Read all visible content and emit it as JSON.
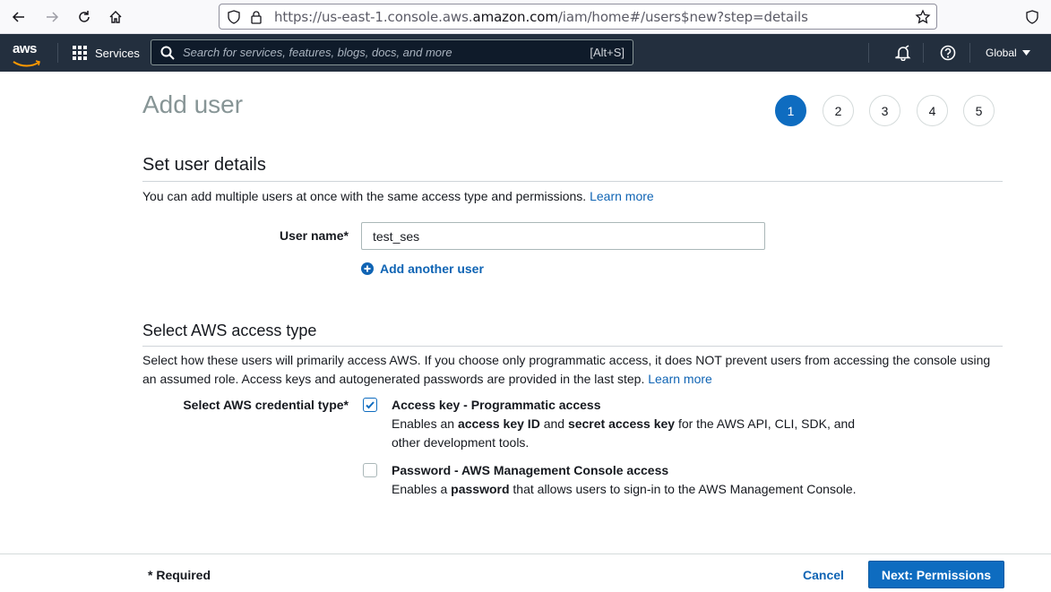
{
  "browser": {
    "url_prefix": "https://us-east-1.console.aws.",
    "url_host": "amazon.com",
    "url_path": "/iam/home#/users$new?step=details"
  },
  "aws_nav": {
    "logo": "aws",
    "services_label": "Services",
    "search_placeholder": "Search for services, features, blogs, docs, and more",
    "search_shortcut": "[Alt+S]",
    "region_label": "Global"
  },
  "page": {
    "title": "Add user",
    "steps": [
      "1",
      "2",
      "3",
      "4",
      "5"
    ],
    "active_step": 1
  },
  "user_details": {
    "title": "Set user details",
    "description": "You can add multiple users at once with the same access type and permissions.",
    "learn_more": "Learn more",
    "username_label": "User name*",
    "username_value": "test_ses",
    "add_another": "Add another user"
  },
  "access_type": {
    "title": "Select AWS access type",
    "description": "Select how these users will primarily access AWS. If you choose only programmatic access, it does NOT prevent users from accessing the console using an assumed role. Access keys and autogenerated passwords are provided in the last step.",
    "learn_more": "Learn more",
    "credential_label": "Select AWS credential type*",
    "options": [
      {
        "title": "Access key - Programmatic access",
        "desc_1": "Enables an ",
        "desc_b1": "access key ID",
        "desc_2": " and ",
        "desc_b2": "secret access key",
        "desc_3": " for the AWS API, CLI, SDK, and other development tools.",
        "checked": true
      },
      {
        "title": "Password - AWS Management Console access",
        "desc_1": "Enables a ",
        "desc_b1": "password",
        "desc_2": " that allows users to sign-in to the AWS Management Console.",
        "checked": false
      }
    ]
  },
  "footer": {
    "required": "* Required",
    "cancel": "Cancel",
    "next": "Next: Permissions"
  },
  "colors": {
    "nav_bg": "#232f3e",
    "primary": "#0e6cc0",
    "link": "#0f64b4"
  }
}
